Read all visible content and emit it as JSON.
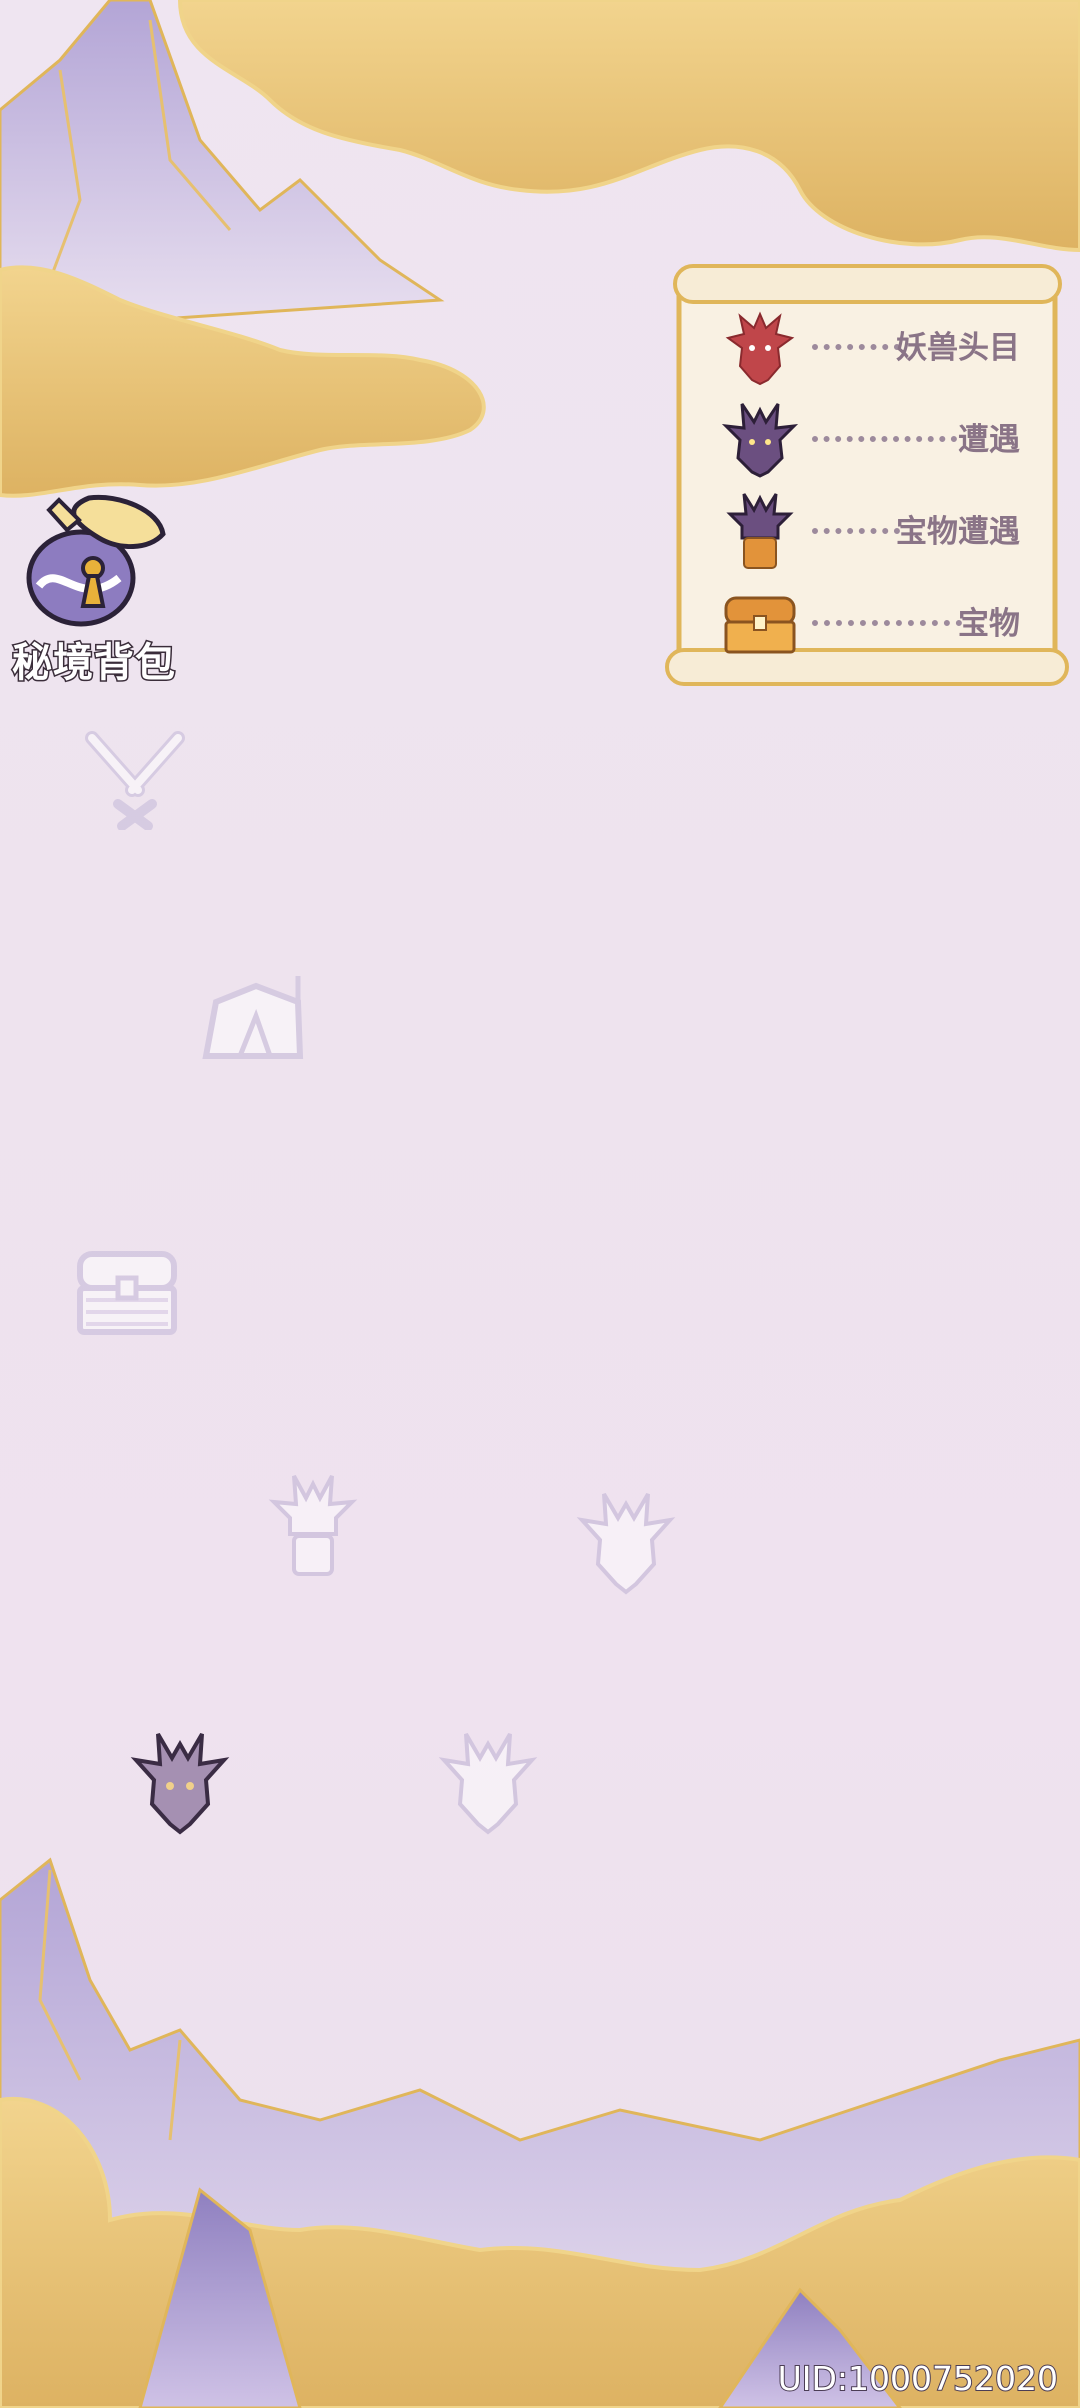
{
  "legend": {
    "items": [
      {
        "label": "妖兽头目",
        "icon": "boss-beast-icon",
        "color": "#c0464a"
      },
      {
        "label": "遭遇",
        "icon": "encounter-beast-icon",
        "color": "#5a3f6e"
      },
      {
        "label": "宝物遭遇",
        "icon": "treasure-encounter-icon",
        "color": "#5a3f6e"
      },
      {
        "label": "宝物",
        "icon": "treasure-chest-icon",
        "color": "#e2933a"
      }
    ]
  },
  "bag": {
    "label": "秘境背包",
    "icon": "treasure-pouch-icon"
  },
  "map_nodes": [
    {
      "kind": "battle",
      "icon": "crossed-swords-icon",
      "state": "faded"
    },
    {
      "kind": "camp",
      "icon": "tent-icon",
      "state": "faded"
    },
    {
      "kind": "treasure",
      "icon": "treasure-chest-icon",
      "state": "faded"
    },
    {
      "kind": "treasure-encounter",
      "icon": "treasure-encounter-icon",
      "state": "faded"
    },
    {
      "kind": "encounter",
      "icon": "encounter-beast-icon",
      "state": "faded"
    },
    {
      "kind": "encounter",
      "icon": "encounter-beast-icon",
      "state": "current"
    },
    {
      "kind": "encounter",
      "icon": "encounter-beast-icon",
      "state": "faded"
    }
  ],
  "uid": "UID:1000752020",
  "colors": {
    "background": "#efe5f1",
    "cloud": "#e8c26a",
    "mountain": "#a89acc",
    "gold_line": "#e0b65a"
  }
}
